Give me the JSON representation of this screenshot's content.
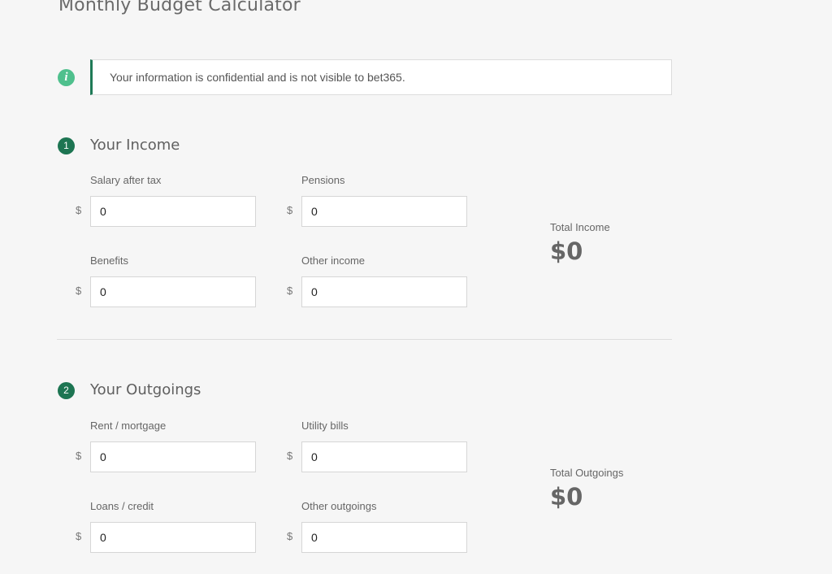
{
  "page": {
    "title": "Monthly Budget Calculator"
  },
  "notice": {
    "text": "Your information is confidential and is not visible to bet365."
  },
  "income": {
    "step": "1",
    "title": "Your Income",
    "currency": "$",
    "fields": {
      "salary": {
        "label": "Salary after tax",
        "value": "0"
      },
      "pensions": {
        "label": "Pensions",
        "value": "0"
      },
      "benefits": {
        "label": "Benefits",
        "value": "0"
      },
      "other": {
        "label": "Other income",
        "value": "0"
      }
    },
    "total_label": "Total Income",
    "total_value": "$0"
  },
  "outgoings": {
    "step": "2",
    "title": "Your Outgoings",
    "currency": "$",
    "fields": {
      "rent": {
        "label": "Rent / mortgage",
        "value": "0"
      },
      "utility": {
        "label": "Utility bills",
        "value": "0"
      },
      "loans": {
        "label": "Loans / credit",
        "value": "0"
      },
      "other": {
        "label": "Other outgoings",
        "value": "0"
      }
    },
    "total_label": "Total Outgoings",
    "total_value": "$0"
  },
  "colors": {
    "accent": "#1d7552",
    "info": "#4fc08d",
    "background": "#f6f6f6"
  },
  "icons": {
    "info": "info-icon"
  }
}
